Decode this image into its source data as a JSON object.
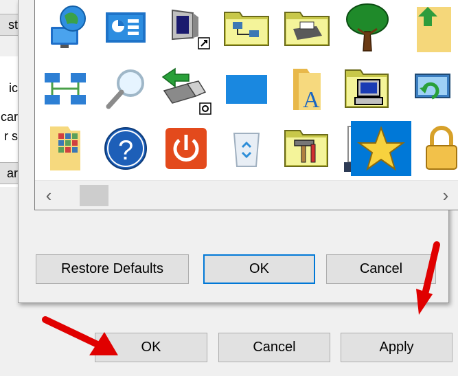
{
  "background_window": {
    "fragments": [
      "st",
      "ic",
      "car",
      "r s",
      "ar"
    ],
    "buttons": {
      "ok": "OK",
      "cancel": "Cancel",
      "apply": "Apply"
    }
  },
  "change_icon_dialog": {
    "icons": [
      {
        "name": "globe-monitor-icon"
      },
      {
        "name": "control-panel-icon"
      },
      {
        "name": "monitor-moon-shortcut-icon"
      },
      {
        "name": "network-folder-icon"
      },
      {
        "name": "printer-folder-icon"
      },
      {
        "name": "tree-icon"
      },
      {
        "name": "folder-green-arrow-icon"
      },
      {
        "name": "network-connections-icon"
      },
      {
        "name": "magnifier-icon"
      },
      {
        "name": "usb-drive-arrow-icon"
      },
      {
        "name": "blue-rectangle-icon"
      },
      {
        "name": "font-folder-icon"
      },
      {
        "name": "computer-folder-icon"
      },
      {
        "name": "monitor-refresh-icon"
      },
      {
        "name": "grid-document-icon"
      },
      {
        "name": "help-icon"
      },
      {
        "name": "power-icon"
      },
      {
        "name": "recycle-bin-icon"
      },
      {
        "name": "tools-folder-icon"
      },
      {
        "name": "checklist-device-icon"
      },
      {
        "name": "star-icon",
        "selected": true
      },
      {
        "name": "lock-icon"
      }
    ],
    "scroll_left": "‹",
    "scroll_right": "›",
    "buttons": {
      "restore_defaults": "Restore Defaults",
      "ok": "OK",
      "cancel": "Cancel"
    }
  },
  "colors": {
    "accent": "#0078d7",
    "annotation_arrow": "#e00000"
  }
}
